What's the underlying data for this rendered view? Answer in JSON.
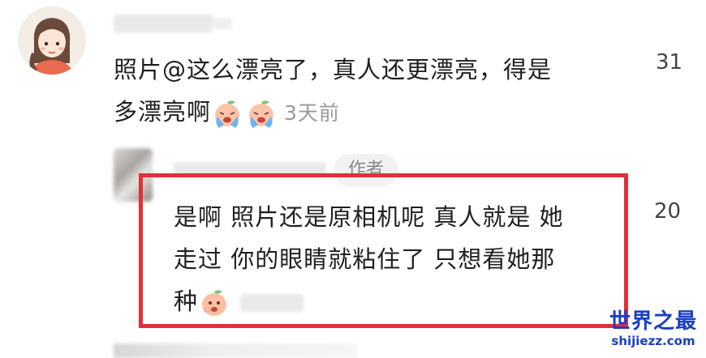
{
  "comment": {
    "text_line1": "照片@这么漂亮了，真人还更漂亮，得是",
    "text_line2": "多漂亮啊",
    "time": "3天前",
    "likes": "31"
  },
  "reply": {
    "author_badge": "作者",
    "text_line1": "是啊 照片还是原相机呢 真人就是 她",
    "text_line2": "走过 你的眼睛就粘住了 只想看她那",
    "text_line3": "种",
    "likes": "20"
  },
  "watermark": {
    "title": "世界之最",
    "url": "shijiezz.com"
  },
  "colors": {
    "highlight": "#e0303a",
    "watermark": "#1a3fbf",
    "badge_bg": "#f2f2f2",
    "meta_gray": "#9a9a9a"
  },
  "icons": [
    "crying-peach-emoji",
    "peeking-peach-emoji"
  ]
}
